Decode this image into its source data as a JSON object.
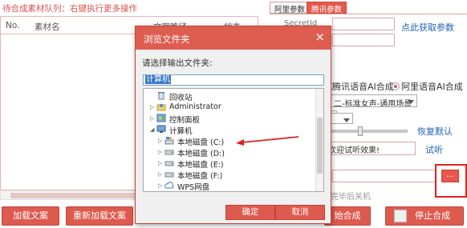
{
  "queue": {
    "title": "待合成素材队列：右键执行更多操作",
    "columns": [
      "No.",
      "素材名",
      "文案路径",
      "状态"
    ]
  },
  "right": {
    "tabs": [
      "阿里参数",
      "腾讯参数"
    ],
    "secret_label": "SecretId",
    "get_params_link": "点此获取参数",
    "voice_option_tencent": "腾讯语音AI合成",
    "voice_option_ali": "阿里语音AI合成",
    "voice_select": "二-标准女声-通用场景",
    "reset_default": "恢复默认",
    "preview_text": "，欢迎试听效果!",
    "listen_link": "试听",
    "browse_label": "...",
    "shutdown_label": "完毕后关机"
  },
  "buttons": {
    "load": "加载文案",
    "reload": "重新加载文案",
    "start": "始合成",
    "stop": "停止合成"
  },
  "dialog": {
    "title": "浏览文件夹",
    "close": "×",
    "prompt": "请选择输出文件夹:",
    "path": "计算机",
    "tree": {
      "recycle": "回收站",
      "admin": "Administrator",
      "control": "控制面板",
      "computer": "计算机",
      "disk_c": "本地磁盘 (C:)",
      "disk_d": "本地磁盘 (D:)",
      "disk_e": "本地磁盘 (E:)",
      "disk_f": "本地磁盘 (F:)",
      "wps": "WPS网盘"
    },
    "ok": "确定",
    "cancel": "取消"
  },
  "colors": {
    "accent": "#de5d51",
    "link": "#1e61b5",
    "annotation": "#e02020"
  }
}
